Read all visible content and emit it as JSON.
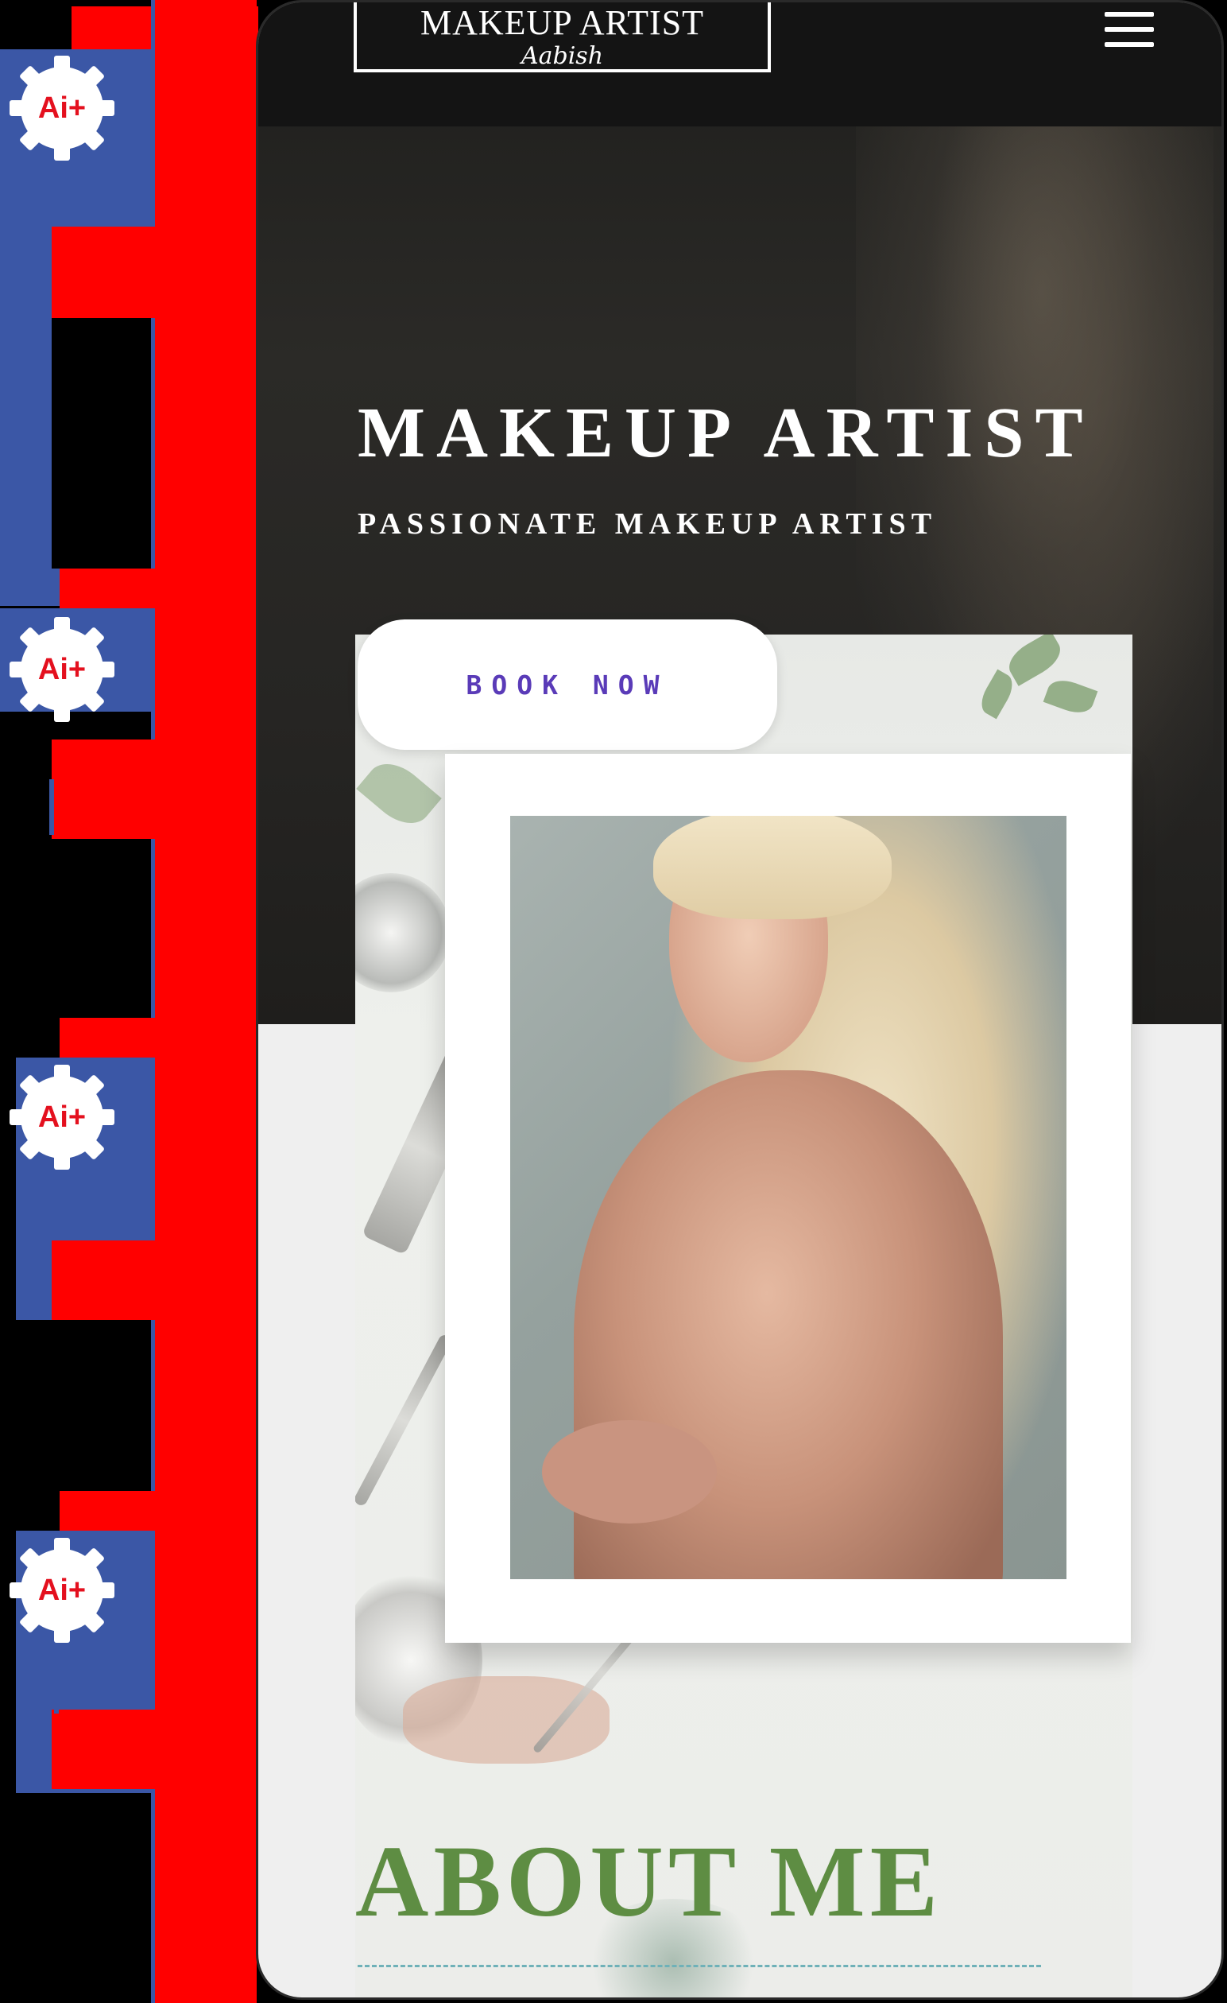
{
  "rail": {
    "badges": [
      {
        "label": "Ai+"
      },
      {
        "label": "Ai+"
      },
      {
        "label": "Ai+"
      },
      {
        "label": "Ai+"
      }
    ],
    "colors": {
      "red": "#ff0000",
      "blue": "#3b57a6",
      "badge_text": "#e4101e"
    }
  },
  "navbar": {
    "logo_title": "MAKEUP ARTIST",
    "logo_signature": "Aabish",
    "menu_icon": "hamburger-menu-icon"
  },
  "hero": {
    "title": "MAKEUP ARTIST",
    "subtitle": "PASSIONATE MAKEUP ARTIST",
    "cta_label": "BOOK NOW"
  },
  "about": {
    "heading": "ABOUT ME"
  },
  "colors": {
    "accent_purple": "#5a3bb8",
    "about_green": "#5e8d43",
    "hero_dark": "#1e1e1c"
  }
}
